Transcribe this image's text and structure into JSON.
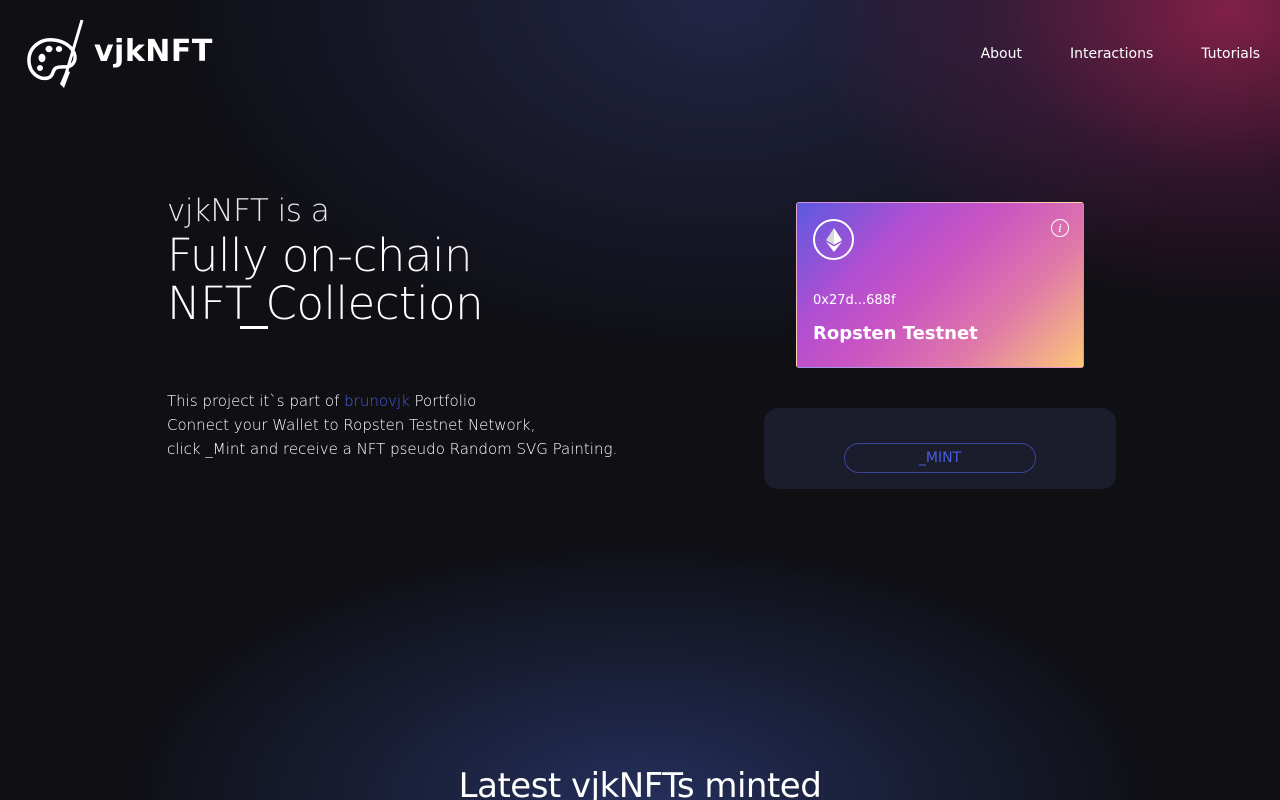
{
  "brand": {
    "name": "vjkNFT",
    "logo_icon": "palette-brush-icon"
  },
  "nav": {
    "items": [
      {
        "label": "About"
      },
      {
        "label": "Interactions"
      },
      {
        "label": "Tutorials"
      }
    ]
  },
  "hero": {
    "line1": "vjkNFT is a",
    "line2": "Fully on-chain",
    "line3": "NFT Collection"
  },
  "description": {
    "line1_prefix": "This project it`s part of ",
    "line1_link": "brunovjk",
    "line1_suffix": " Portfolio",
    "line2": "Connect your Wallet to Ropsten Testnet Network,",
    "line3": "click _Mint and receive a NFT pseudo Random SVG Painting."
  },
  "wallet": {
    "icon": "ethereum-icon",
    "info_icon": "info-icon",
    "info_glyph": "i",
    "address": "0x27d...688f",
    "network": "Ropsten Testnet"
  },
  "mint": {
    "label": "_MINT"
  },
  "latest": {
    "title": "Latest vjkNFTs minted"
  },
  "colors": {
    "background": "#0f0f14",
    "link": "#4a5ce0",
    "panel": "#1b1d2d",
    "card_gradient_start": "#5a5ae0",
    "card_gradient_end": "#fcc777"
  }
}
